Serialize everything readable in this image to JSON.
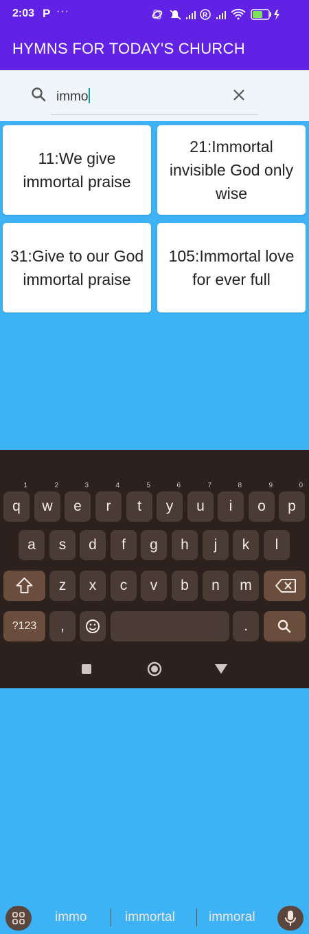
{
  "status": {
    "time": "2:03",
    "p_icon": "P",
    "dots": "···",
    "battery": "54"
  },
  "app": {
    "title": "HYMNS FOR TODAY'S CHURCH"
  },
  "search": {
    "value": "immo"
  },
  "results": [
    {
      "label": "11:We give immortal praise"
    },
    {
      "label": "21:Immortal invisible God only wise"
    },
    {
      "label": "31:Give to our God immortal praise"
    },
    {
      "label": "105:Immortal love for ever full"
    }
  ],
  "keyboard": {
    "suggestions": [
      "immo",
      "immortal",
      "immoral"
    ],
    "row1": [
      {
        "key": "q",
        "hint": "1"
      },
      {
        "key": "w",
        "hint": "2"
      },
      {
        "key": "e",
        "hint": "3"
      },
      {
        "key": "r",
        "hint": "4"
      },
      {
        "key": "t",
        "hint": "5"
      },
      {
        "key": "y",
        "hint": "6"
      },
      {
        "key": "u",
        "hint": "7"
      },
      {
        "key": "i",
        "hint": "8"
      },
      {
        "key": "o",
        "hint": "9"
      },
      {
        "key": "p",
        "hint": "0"
      }
    ],
    "row2": [
      "a",
      "s",
      "d",
      "f",
      "g",
      "h",
      "j",
      "k",
      "l"
    ],
    "row3": [
      "z",
      "x",
      "c",
      "v",
      "b",
      "n",
      "m"
    ],
    "symbols_key": "?123",
    "comma_key": ",",
    "period_key": "."
  },
  "colors": {
    "appbar": "#6222e6",
    "background": "#3db3f5",
    "keyboard": "#2c211c"
  }
}
